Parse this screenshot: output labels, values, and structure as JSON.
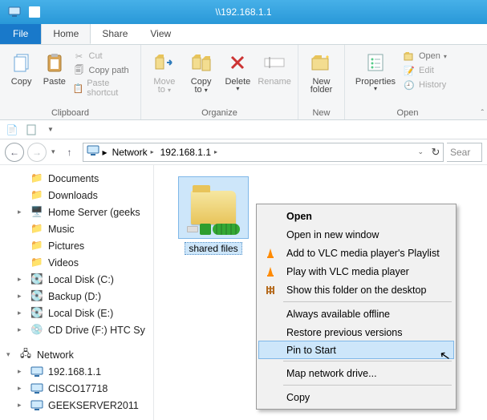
{
  "window": {
    "title": "\\\\192.168.1.1"
  },
  "tabs": {
    "file": "File",
    "home": "Home",
    "share": "Share",
    "view": "View"
  },
  "ribbon": {
    "clipboard": {
      "label": "Clipboard",
      "copy": "Copy",
      "paste": "Paste",
      "cut": "Cut",
      "copypath": "Copy path",
      "pasteshortcut": "Paste shortcut"
    },
    "organize": {
      "label": "Organize",
      "moveto": "Move",
      "moveto2": "to",
      "copyto": "Copy",
      "copyto2": "to",
      "delete": "Delete",
      "rename": "Rename"
    },
    "new": {
      "label": "New",
      "newfolder": "New",
      "newfolder2": "folder"
    },
    "open": {
      "label": "Open",
      "properties": "Properties",
      "open": "Open",
      "edit": "Edit",
      "history": "History"
    }
  },
  "address": {
    "root": "Network",
    "node": "192.168.1.1",
    "refresh_tip": "Refresh",
    "search_placeholder": "Sear"
  },
  "tree": {
    "documents": "Documents",
    "downloads": "Downloads",
    "homeserver": "Home Server (geeks",
    "music": "Music",
    "pictures": "Pictures",
    "videos": "Videos",
    "localc": "Local Disk (C:)",
    "backup": "Backup (D:)",
    "locale": "Local Disk (E:)",
    "cddrive": "CD Drive (F:) HTC Sy",
    "network": "Network",
    "ip": "192.168.1.1",
    "cisco": "CISCO17718",
    "geek": "GEEKSERVER2011"
  },
  "item": {
    "name": "shared files"
  },
  "menu": {
    "open": "Open",
    "opennew": "Open in new window",
    "addvlc": "Add to VLC media player's Playlist",
    "playvlc": "Play with VLC media player",
    "showdesk": "Show this folder on the desktop",
    "offline": "Always available offline",
    "restore": "Restore previous versions",
    "pin": "Pin to Start",
    "mapdrive": "Map network drive...",
    "copy": "Copy"
  }
}
